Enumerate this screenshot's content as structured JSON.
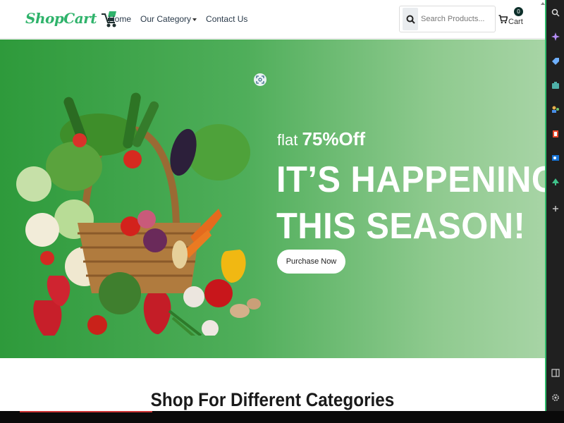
{
  "brand": {
    "name": "ShopCart"
  },
  "nav": {
    "home": "Home",
    "category": "Our Category",
    "contact": "Contact Us"
  },
  "search": {
    "placeholder": "Search Products..."
  },
  "cart": {
    "label": "Cart",
    "count": "0"
  },
  "hero": {
    "sub_prefix": "flat ",
    "sub_offer": "75%Off",
    "title_line1": "IT’S HAPPENING",
    "title_line2": "THIS SEASON!",
    "button": "Purchase Now"
  },
  "section": {
    "categories_title": "Shop For Different Categories"
  },
  "colors": {
    "brand_green": "#2fb36b",
    "hero_start": "#2e9a3b",
    "hero_end": "#a7d4a5",
    "badge": "#0d2f2a"
  },
  "icons": [
    "shopping-cart-logo-icon",
    "search-icon",
    "cart-icon",
    "scan-icon",
    "copilot-icon",
    "tag-icon",
    "briefcase-icon",
    "people-icon",
    "office-icon",
    "outlook-icon",
    "tree-icon",
    "plus-icon",
    "sidebar-exit-icon",
    "settings-icon"
  ]
}
